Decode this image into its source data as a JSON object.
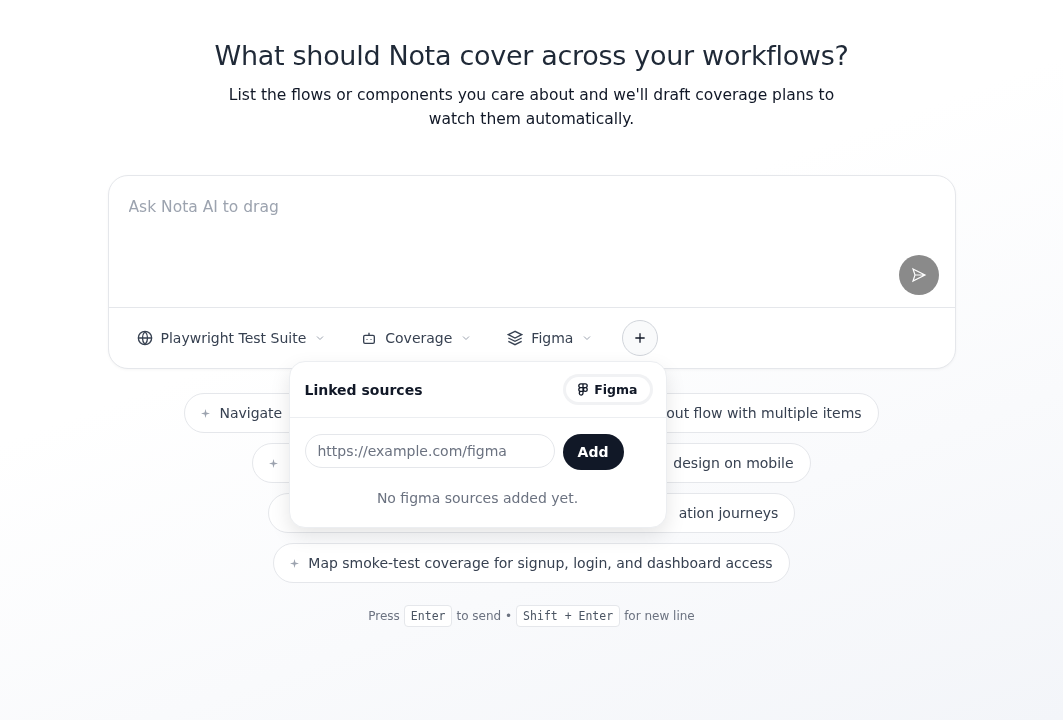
{
  "heading": {
    "title": "What should Nota cover across your workflows?",
    "subtitle": "List the flows or components you care about and we'll draft coverage plans to watch them automatically."
  },
  "composer": {
    "placeholder": "Ask Nota AI to drag",
    "selectors": [
      {
        "kind": "globe",
        "label": "Playwright Test Suite"
      },
      {
        "kind": "bot",
        "label": "Coverage"
      },
      {
        "kind": "layers",
        "label": "Figma"
      }
    ]
  },
  "popover": {
    "title": "Linked sources",
    "badge": "Figma",
    "url_placeholder": "https://example.com/figma",
    "add_button": "Add",
    "empty_message": "No figma sources added yet."
  },
  "suggestions": [
    {
      "sparkle_visible": true,
      "start": "Navigate",
      "end": "out flow with multiple items"
    },
    {
      "sparkle_visible": true,
      "end": "design on mobile"
    },
    {
      "sparkle_visible": false,
      "end": "ation journeys"
    },
    {
      "sparkle_visible": true,
      "start": "Map smoke-test coverage for signup, login, and dashboard access"
    }
  ],
  "hint": {
    "before": "Press",
    "key1": "Enter",
    "middle": "to send •",
    "key2": "Shift + Enter",
    "after": "for new line"
  }
}
